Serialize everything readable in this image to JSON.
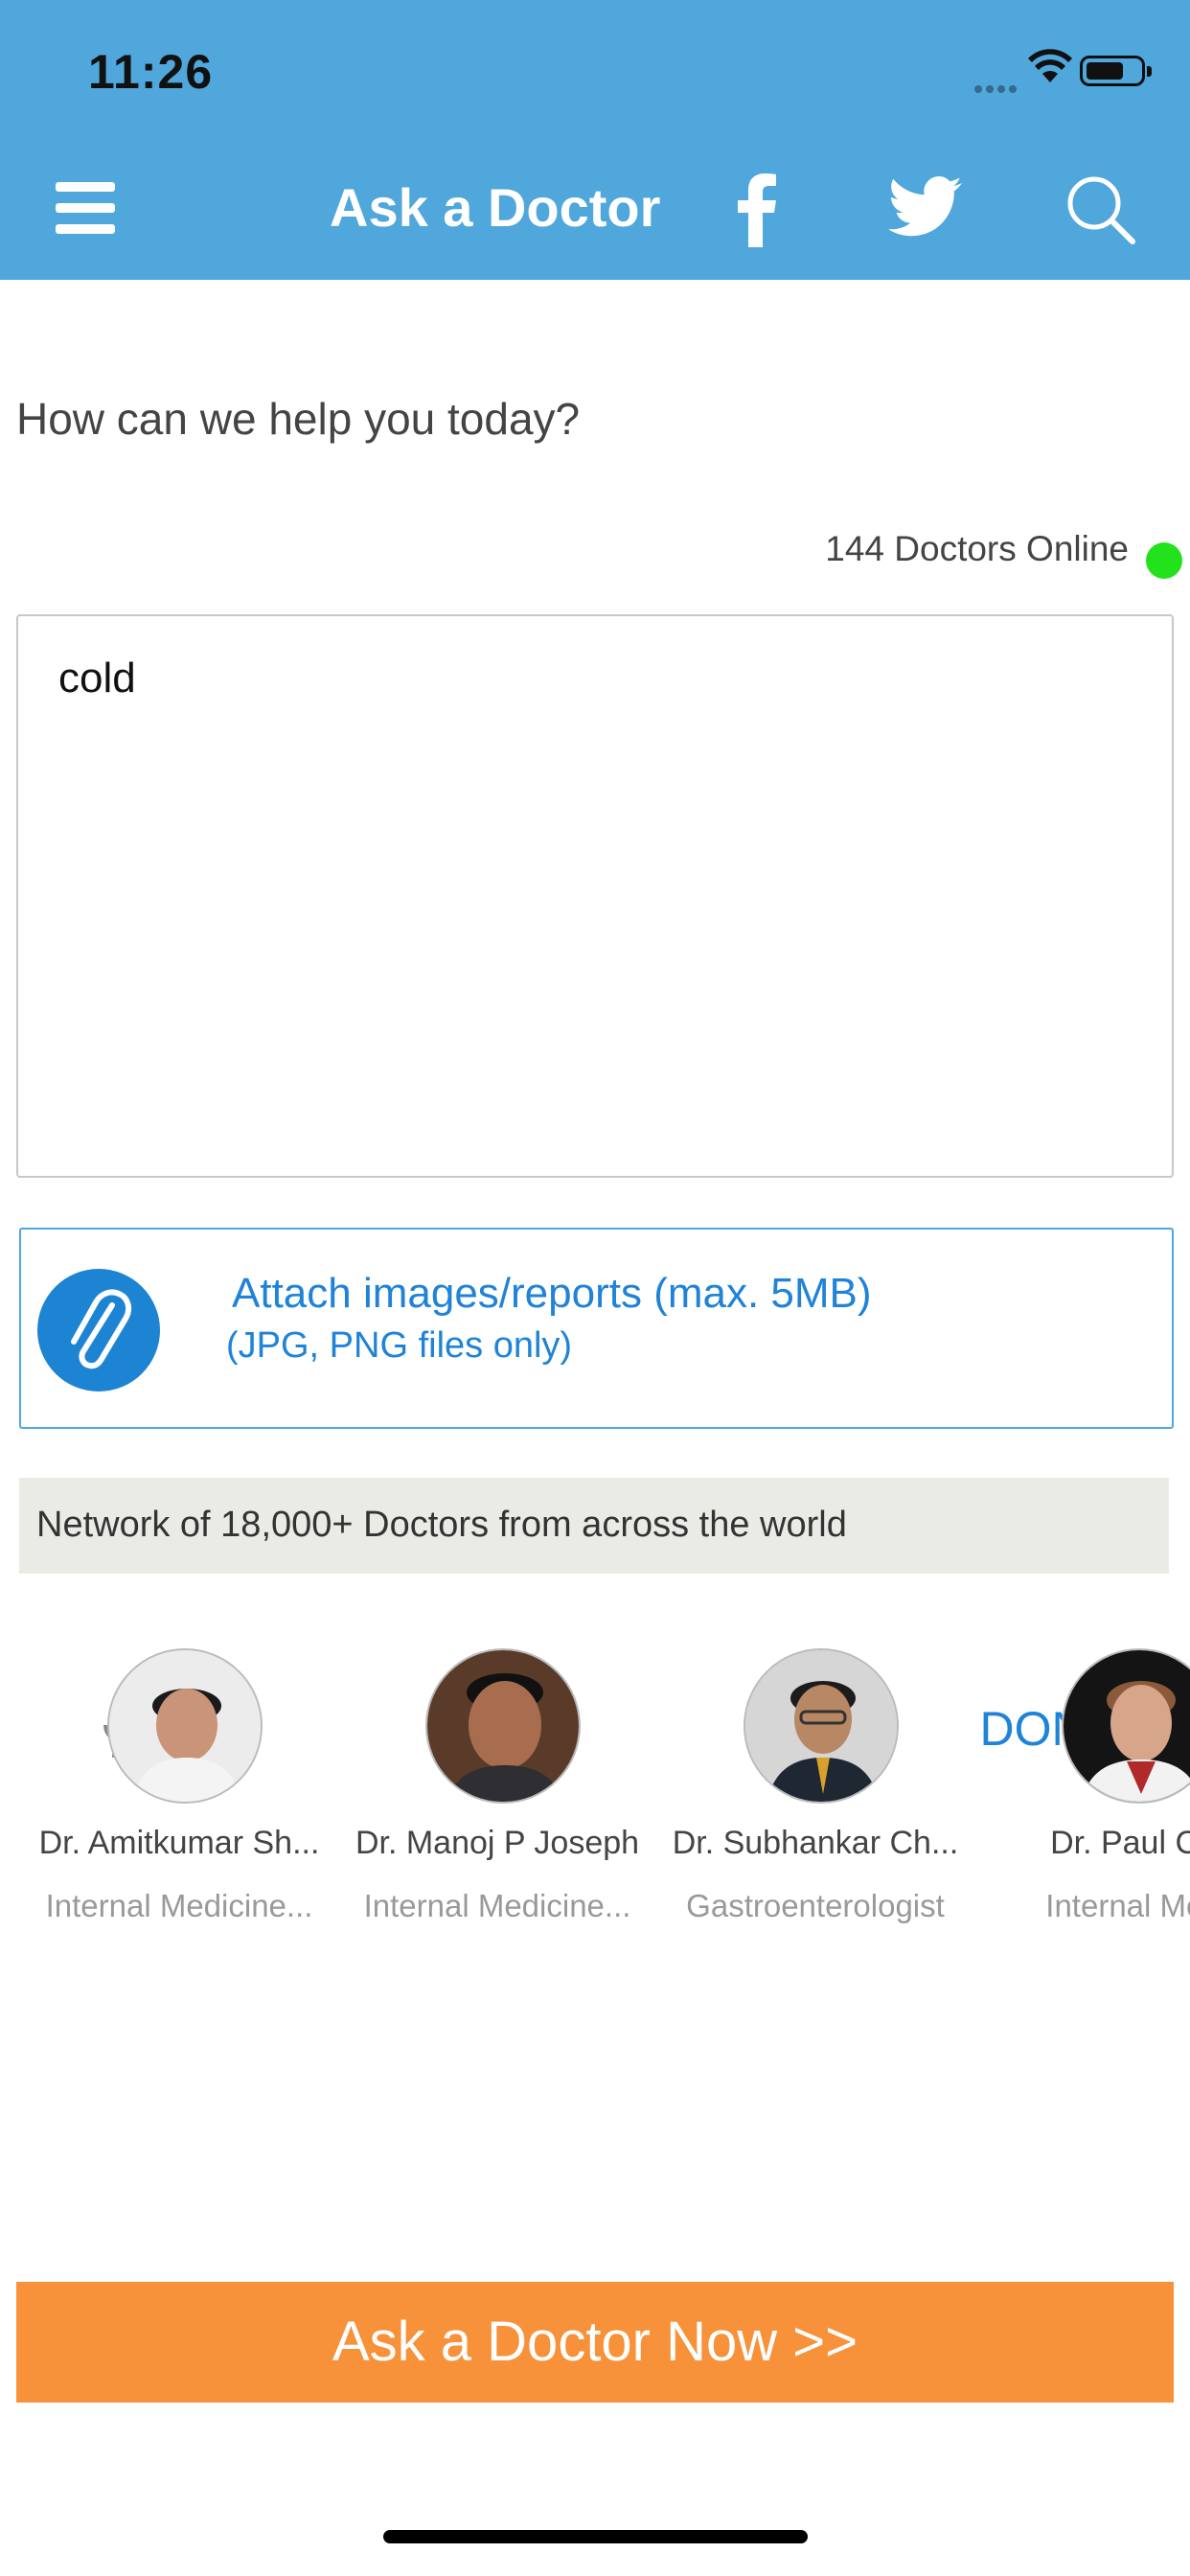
{
  "status_bar": {
    "time": "11:26"
  },
  "header": {
    "title": "Ask a Doctor",
    "colors": {
      "background": "#4fa7db"
    }
  },
  "main": {
    "prompt": "How can we help you today?",
    "online_text": "144 Doctors Online",
    "question_input": {
      "value": "cold"
    },
    "done_label": "DONE",
    "attach": {
      "title": "Attach images/reports (max. 5MB)",
      "subtitle": "(JPG, PNG files only)"
    },
    "network_text": "Network of 18,000+ Doctors from across the world",
    "doctors": [
      {
        "name": "Dr. Amitkumar Sh...",
        "specialty": "Internal Medicine..."
      },
      {
        "name": "Dr. Manoj P Joseph",
        "specialty": "Internal Medicine..."
      },
      {
        "name": "Dr. Subhankar Ch...",
        "specialty": "Gastroenterologist"
      },
      {
        "name": "Dr. Paul Ca",
        "specialty": "Internal Med"
      }
    ],
    "cta_label": "Ask a Doctor Now >>"
  }
}
